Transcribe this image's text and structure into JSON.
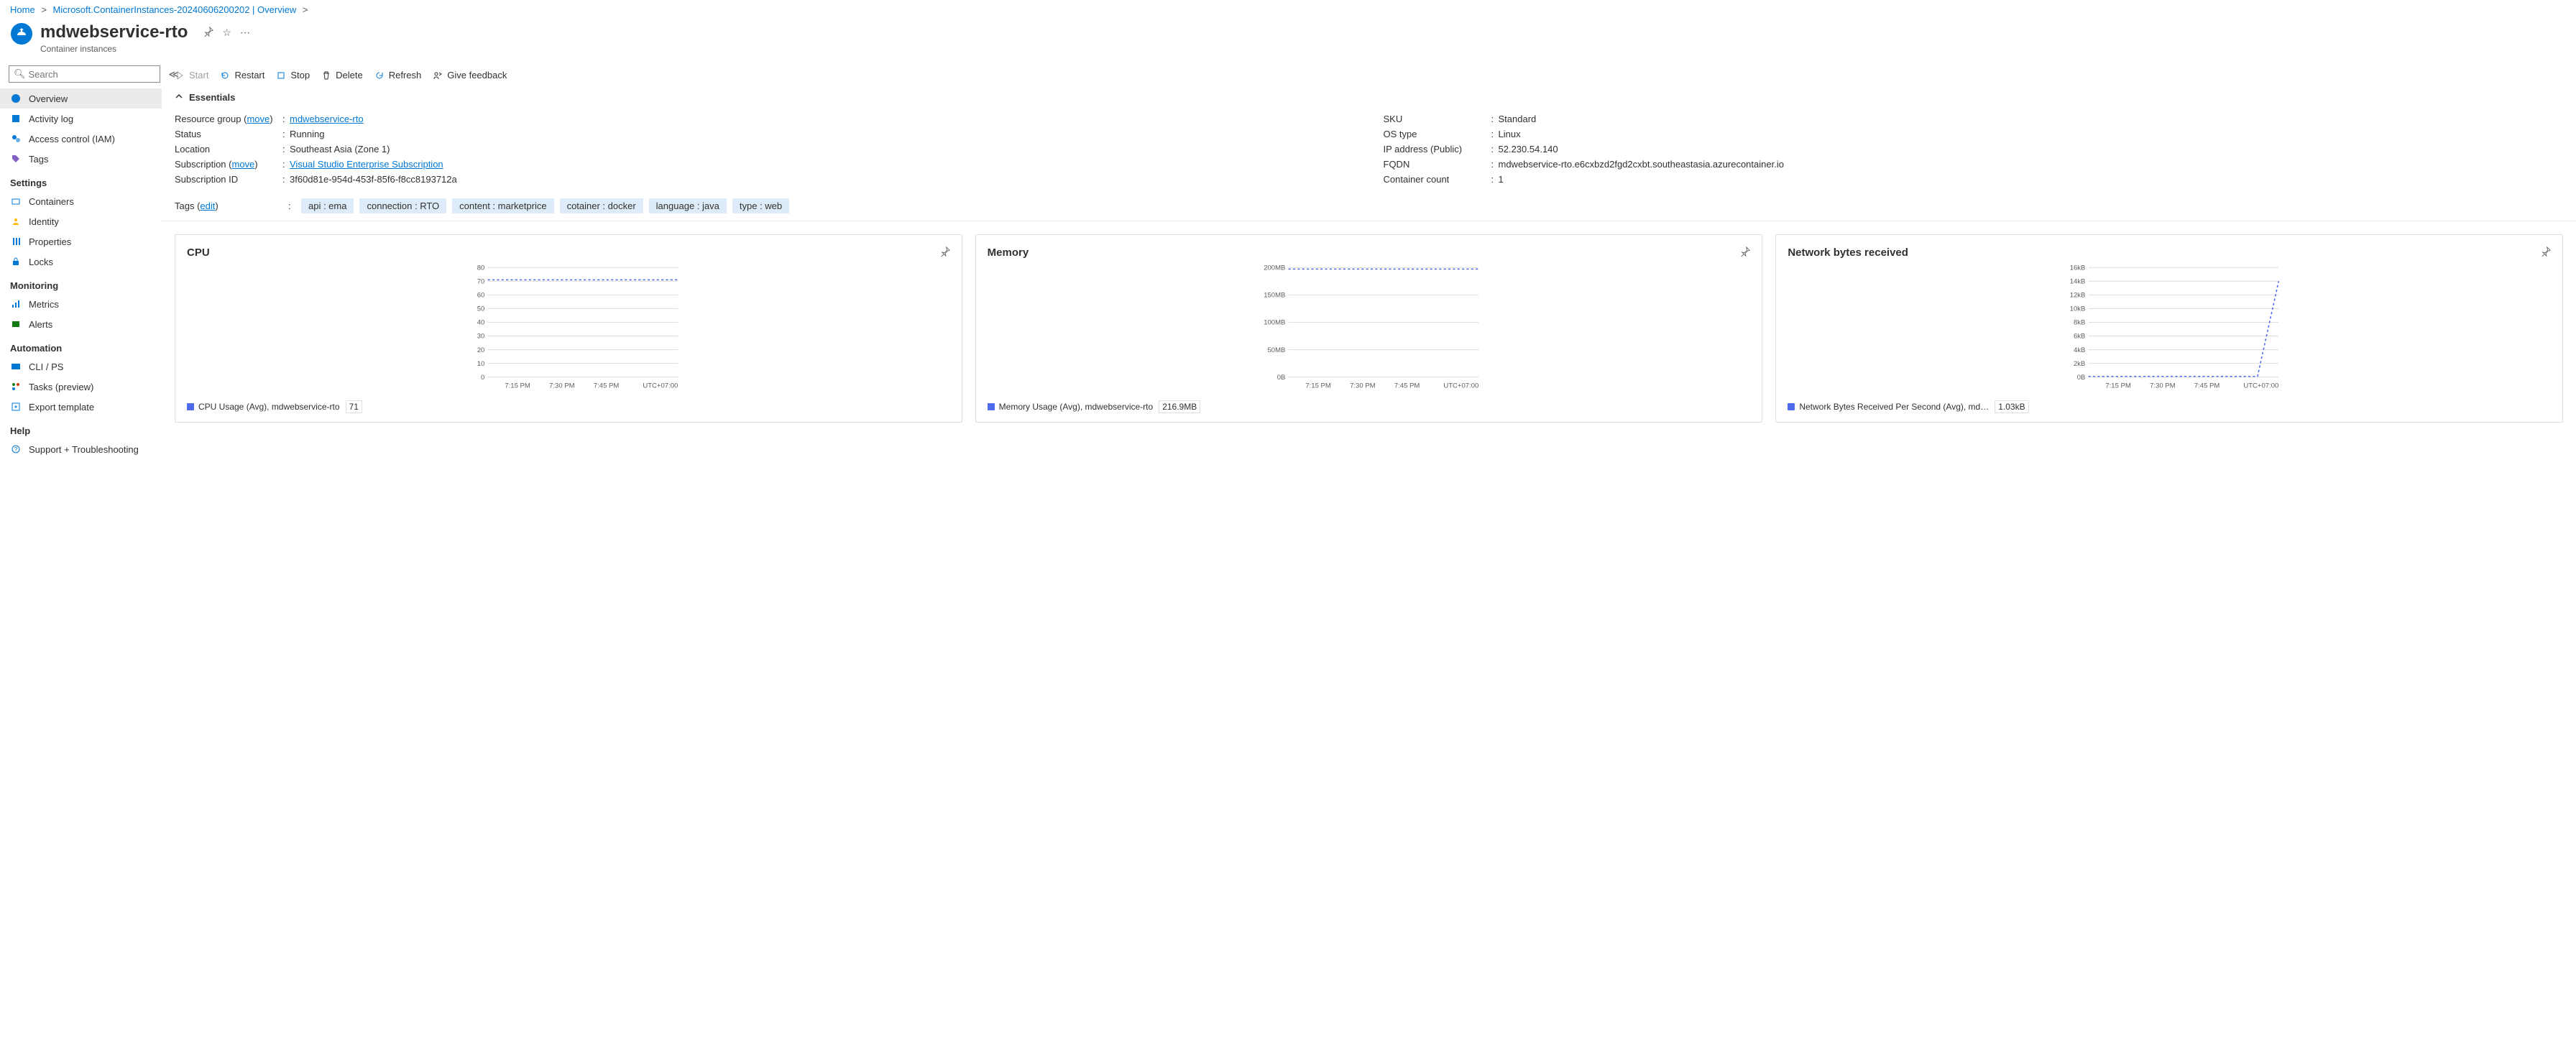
{
  "breadcrumb": {
    "home": "Home",
    "group": "Microsoft.ContainerInstances-20240606200202 | Overview"
  },
  "header": {
    "title": "mdwebservice-rto",
    "subtitle": "Container instances"
  },
  "search": {
    "placeholder": "Search"
  },
  "sidebar": {
    "items": [
      {
        "label": "Overview"
      },
      {
        "label": "Activity log"
      },
      {
        "label": "Access control (IAM)"
      },
      {
        "label": "Tags"
      }
    ],
    "settings_group": "Settings",
    "settings": [
      {
        "label": "Containers"
      },
      {
        "label": "Identity"
      },
      {
        "label": "Properties"
      },
      {
        "label": "Locks"
      }
    ],
    "monitoring_group": "Monitoring",
    "monitoring": [
      {
        "label": "Metrics"
      },
      {
        "label": "Alerts"
      }
    ],
    "automation_group": "Automation",
    "automation": [
      {
        "label": "CLI / PS"
      },
      {
        "label": "Tasks (preview)"
      },
      {
        "label": "Export template"
      }
    ],
    "help_group": "Help",
    "help": [
      {
        "label": "Support + Troubleshooting"
      }
    ]
  },
  "commands": {
    "start": "Start",
    "restart": "Restart",
    "stop": "Stop",
    "delete": "Delete",
    "refresh": "Refresh",
    "feedback": "Give feedback"
  },
  "essentials": {
    "header": "Essentials",
    "left": {
      "resource_group_label": "Resource group (",
      "resource_group_move": "move",
      "resource_group_link": "mdwebservice-rto",
      "status_label": "Status",
      "status_val": "Running",
      "location_label": "Location",
      "location_val": "Southeast Asia (Zone 1)",
      "subscription_label": "Subscription (",
      "subscription_move": "move",
      "subscription_link": "Visual Studio Enterprise Subscription",
      "subid_label": "Subscription ID",
      "subid_val": "3f60d81e-954d-453f-85f6-f8cc8193712a"
    },
    "right": {
      "sku_label": "SKU",
      "sku_val": "Standard",
      "os_label": "OS type",
      "os_val": "Linux",
      "ip_label": "IP address (Public)",
      "ip_val": "52.230.54.140",
      "fqdn_label": "FQDN",
      "fqdn_val": "mdwebservice-rto.e6cxbzd2fgd2cxbt.southeastasia.azurecontainer.io",
      "count_label": "Container count",
      "count_val": "1"
    }
  },
  "tags": {
    "label": "Tags (",
    "edit": "edit",
    "items": [
      "api : ema",
      "connection : RTO",
      "content : marketprice",
      "cotainer : docker",
      "language : java",
      "type : web"
    ]
  },
  "chart_data": [
    {
      "type": "line",
      "title": "CPU",
      "x_labels": [
        "7:15 PM",
        "7:30 PM",
        "7:45 PM"
      ],
      "tz": "UTC+07:00",
      "y_ticks": [
        0,
        10,
        20,
        30,
        40,
        50,
        60,
        70,
        80
      ],
      "ylim": [
        0,
        80
      ],
      "values": [
        71,
        71,
        71,
        71,
        71,
        71,
        71,
        71,
        71,
        71
      ],
      "legend": "CPU Usage (Avg), mdwebservice-rto",
      "legend_value": "71"
    },
    {
      "type": "line",
      "title": "Memory",
      "x_labels": [
        "7:15 PM",
        "7:30 PM",
        "7:45 PM"
      ],
      "tz": "UTC+07:00",
      "y_ticks_str": [
        "0B",
        "50MB",
        "100MB",
        "150MB",
        "200MB"
      ],
      "ylim": [
        0,
        220
      ],
      "values": [
        216.9,
        216.9,
        216.9,
        216.9,
        216.9,
        216.9,
        216.9,
        216.9,
        216.9,
        216.9
      ],
      "legend": "Memory Usage (Avg), mdwebservice-rto",
      "legend_value": "216.9MB"
    },
    {
      "type": "line",
      "title": "Network bytes received",
      "x_labels": [
        "7:15 PM",
        "7:30 PM",
        "7:45 PM"
      ],
      "tz": "UTC+07:00",
      "y_ticks_str": [
        "0B",
        "2kB",
        "4kB",
        "6kB",
        "8kB",
        "10kB",
        "12kB",
        "14kB",
        "16kB"
      ],
      "ylim": [
        0,
        16
      ],
      "values": [
        0.1,
        0.1,
        0.1,
        0.1,
        0.1,
        0.1,
        0.1,
        0.1,
        0.1,
        14.0
      ],
      "legend": "Network Bytes Received Per Second (Avg), md…",
      "legend_value": "1.03kB"
    }
  ]
}
